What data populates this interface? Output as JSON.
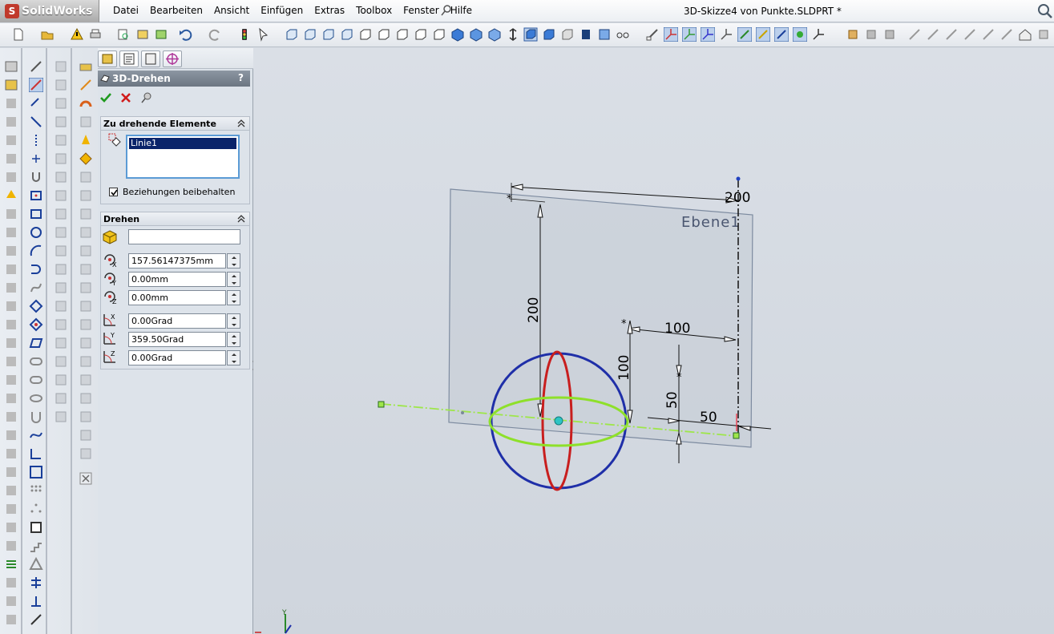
{
  "app": {
    "brand": "SolidWorks",
    "document_title": "3D-Skizze4 von Punkte.SLDPRT *"
  },
  "menu": [
    "Datei",
    "Bearbeiten",
    "Ansicht",
    "Einfügen",
    "Extras",
    "Toolbox",
    "Fenster",
    "Hilfe"
  ],
  "property_manager": {
    "title": "3D-Drehen",
    "help": "?",
    "group_elements": {
      "header": "Zu drehende Elemente",
      "selected_item": "Linie1",
      "keep_relations_label": "Beziehungen beibehalten",
      "keep_relations_checked": true
    },
    "group_rotate": {
      "header": "Drehen",
      "reference_value": "",
      "x_axis_point": "157.56147375mm",
      "y_axis_point": "0.00mm",
      "z_axis_point": "0.00mm",
      "angle_x": "0.00Grad",
      "angle_y": "359.50Grad",
      "angle_z": "0.00Grad"
    }
  },
  "viewport": {
    "plane_label": "Ebene1",
    "dimensions": [
      "200",
      "200",
      "100",
      "100",
      "50",
      "50"
    ],
    "triad_y_label": "Y",
    "colors": {
      "plane": "#9aa7b8",
      "sphere_blue": "#1f2fa8",
      "ring_red": "#c81e1e",
      "ring_green": "#8ee02a",
      "axis": "#111111"
    }
  }
}
